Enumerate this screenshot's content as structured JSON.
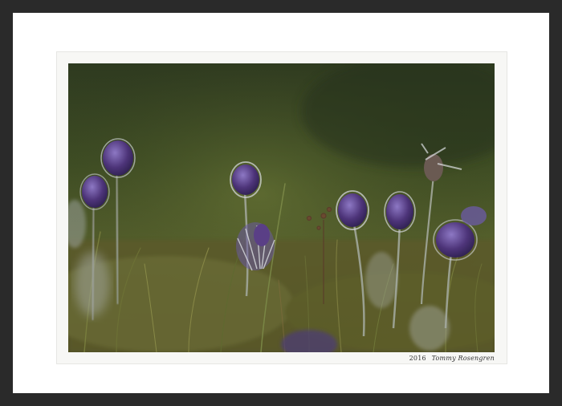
{
  "colors": {
    "frame": "#2a2a2a",
    "mat": "#ffffff",
    "border": "#f7f7f5",
    "grass_dark": "#2f3a1a",
    "grass_mid": "#5d6a30",
    "petal": "#5a3f86",
    "petal_light": "#8b76b8",
    "fuzz": "#cfd3d6"
  },
  "caption": {
    "year": "2016",
    "author": "Tommy Rosengren"
  }
}
